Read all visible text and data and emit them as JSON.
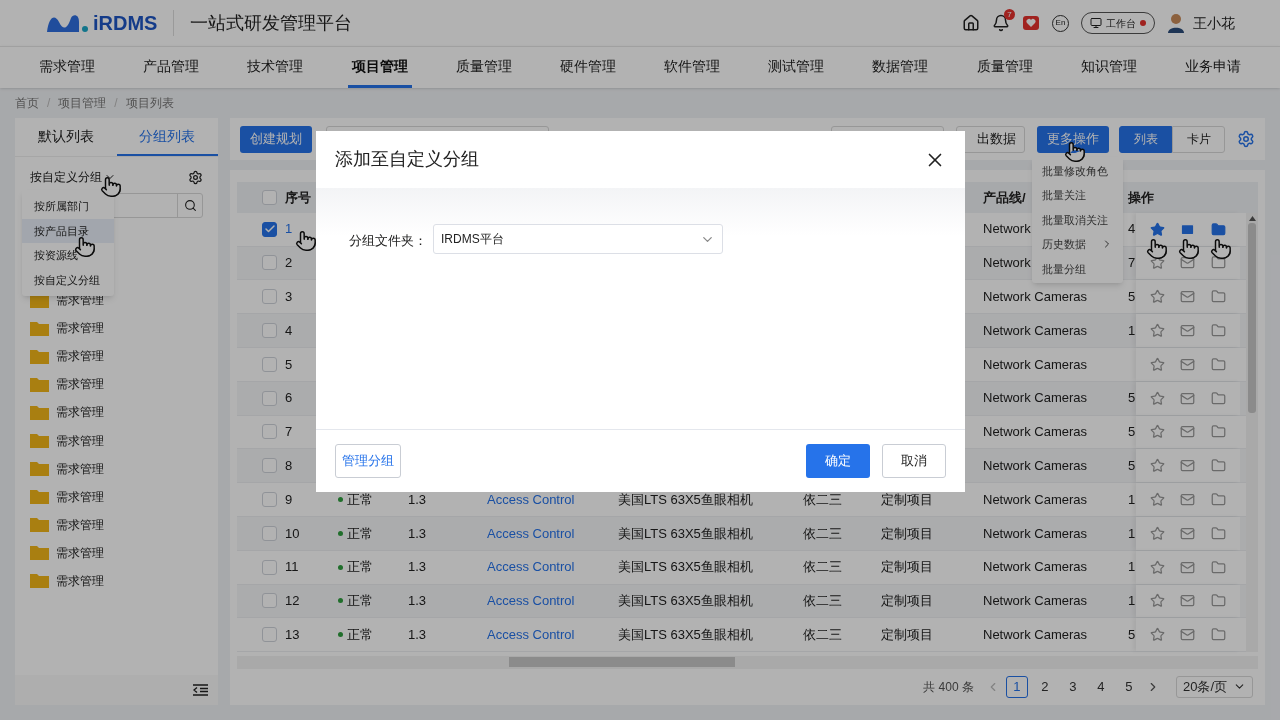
{
  "header": {
    "logo": "iRDMS",
    "title": "一站式研发管理平台",
    "notification_count": "7",
    "lang": "En",
    "workbench": "工作台",
    "user": "王小花"
  },
  "nav": [
    {
      "label": "需求管理",
      "selected": false
    },
    {
      "label": "产品管理",
      "selected": false
    },
    {
      "label": "技术管理",
      "selected": false
    },
    {
      "label": "项目管理",
      "selected": true
    },
    {
      "label": "质量管理",
      "selected": false
    },
    {
      "label": "硬件管理",
      "selected": false
    },
    {
      "label": "软件管理",
      "selected": false
    },
    {
      "label": "测试管理",
      "selected": false
    },
    {
      "label": "数据管理",
      "selected": false
    },
    {
      "label": "质量管理",
      "selected": false
    },
    {
      "label": "知识管理",
      "selected": false
    },
    {
      "label": "业务申请",
      "selected": false
    }
  ],
  "breadcrumb": {
    "separator": "/",
    "items": [
      "首页",
      "项目管理",
      "项目列表"
    ]
  },
  "sidebar": {
    "tabs": [
      {
        "label": "默认列表",
        "selected": false
      },
      {
        "label": "分组列表",
        "selected": true
      }
    ],
    "group_by": "按自定义分组",
    "dropdown": [
      {
        "label": "按所属部门",
        "selected": false
      },
      {
        "label": "按产品目录",
        "selected": true
      },
      {
        "label": "按资源线",
        "selected": false
      },
      {
        "label": "按自定义分组",
        "selected": false
      }
    ],
    "folders": [
      "需求管理",
      "需求管理",
      "需求管理",
      "需求管理",
      "需求管理",
      "需求管理",
      "需求管理",
      "需求管理",
      "需求管理",
      "需求管理",
      "需求管理"
    ]
  },
  "toolbar": {
    "create": "创建规划",
    "export": "出数据",
    "more": "更多操作",
    "views": [
      {
        "label": "列表",
        "selected": true
      },
      {
        "label": "卡片",
        "selected": false
      }
    ]
  },
  "more_menu": [
    {
      "label": "批量修改角色",
      "submenu": false
    },
    {
      "label": "批量关注",
      "submenu": false
    },
    {
      "label": "批量取消关注",
      "submenu": false
    },
    {
      "label": "历史数据",
      "submenu": true
    },
    {
      "label": "批量分组",
      "submenu": false
    }
  ],
  "table": {
    "header": {
      "select_all_checked": false,
      "index": "序号",
      "product_line": "产品线/",
      "actions": "操作"
    },
    "rows": [
      {
        "index": "1",
        "checked": true,
        "followed": true,
        "product_line": "Network",
        "column_9": "4"
      },
      {
        "index": "2",
        "checked": false,
        "followed": false,
        "product_line": "Network",
        "column_9": "7"
      },
      {
        "index": "3",
        "checked": false,
        "followed": false,
        "product_line": "Network Cameras",
        "column_9": "5"
      },
      {
        "index": "4",
        "checked": false,
        "followed": false,
        "product_line": "Network Cameras",
        "column_9": "1"
      },
      {
        "index": "5",
        "checked": false,
        "followed": false,
        "product_line": "Network Cameras"
      },
      {
        "index": "6",
        "checked": false,
        "followed": false,
        "product_line": "Network Cameras",
        "column_9": "5"
      },
      {
        "index": "7",
        "checked": false,
        "followed": false,
        "product_line": "Network Cameras",
        "column_9": "5"
      },
      {
        "index": "8",
        "checked": false,
        "followed": false,
        "product_line": "Network Cameras",
        "column_9": "5"
      },
      {
        "index": "9",
        "checked": false,
        "followed": false,
        "status": {
          "label": "正常"
        },
        "version": "1.3",
        "name": "Access Control",
        "product": "美国LTS 63X5鱼眼相机",
        "owner": "依二三",
        "type": "定制项目",
        "product_line": "Network Cameras",
        "column_9": "1"
      },
      {
        "index": "10",
        "checked": false,
        "followed": false,
        "status": {
          "label": "正常"
        },
        "version": "1.3",
        "name": "Access Control",
        "product": "美国LTS 63X5鱼眼相机",
        "owner": "依二三",
        "type": "定制项目",
        "product_line": "Network Cameras",
        "column_9": "1"
      },
      {
        "index": "11",
        "checked": false,
        "followed": false,
        "status": {
          "label": "正常"
        },
        "version": "1.3",
        "name": "Access Control",
        "product": "美国LTS 63X5鱼眼相机",
        "owner": "依二三",
        "type": "定制项目",
        "product_line": "Network Cameras",
        "column_9": "1"
      },
      {
        "index": "12",
        "checked": false,
        "followed": false,
        "status": {
          "label": "正常"
        },
        "version": "1.3",
        "name": "Access Control",
        "product": "美国LTS 63X5鱼眼相机",
        "owner": "依二三",
        "type": "定制项目",
        "product_line": "Network Cameras",
        "column_9": "1"
      },
      {
        "index": "13",
        "checked": false,
        "followed": false,
        "status": {
          "label": "正常"
        },
        "version": "1.3",
        "name": "Access Control",
        "product": "美国LTS 63X5鱼眼相机",
        "owner": "依二三",
        "type": "定制项目",
        "product_line": "Network Cameras",
        "column_9": "5"
      }
    ]
  },
  "pagination": {
    "total": "共 400 条",
    "pages": [
      {
        "label": "1",
        "selected": true
      },
      {
        "label": "2",
        "selected": false
      },
      {
        "label": "3",
        "selected": false
      },
      {
        "label": "4",
        "selected": false
      },
      {
        "label": "5",
        "selected": false
      }
    ],
    "page_size": "20条/页"
  },
  "dialog": {
    "title": "添加至自定义分组",
    "field_label": "分组文件夹：",
    "field_value": "IRDMS平台",
    "manage": "管理分组",
    "ok": "确定",
    "cancel": "取消"
  }
}
